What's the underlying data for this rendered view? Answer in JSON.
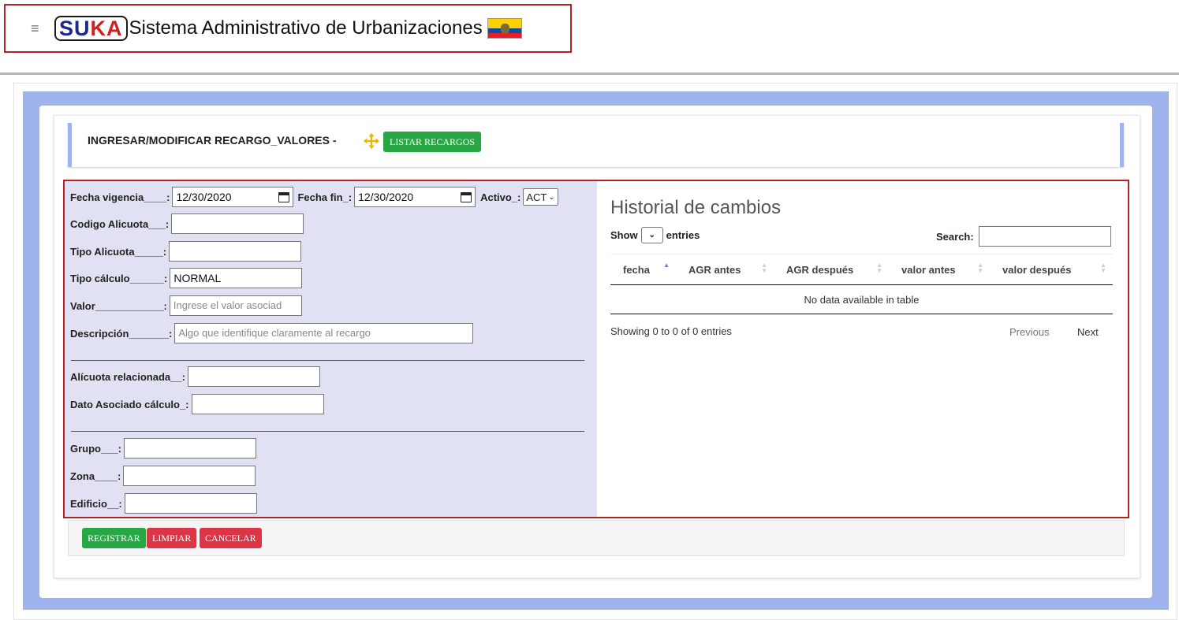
{
  "header": {
    "app_title": "Sistema Administrativo de Urbanizaciones",
    "logo_part1": "SU",
    "logo_part2": "KA",
    "menu_icon": "≡"
  },
  "panel": {
    "title": "INGRESAR/MODIFICAR RECARGO_VALORES -",
    "move_icon": "move-arrows-icon",
    "list_button": "LISTAR RECARGOS"
  },
  "form": {
    "fecha_vigencia_label": "Fecha vigencia____:",
    "fecha_vigencia_value": "12/30/2020",
    "fecha_fin_label": "Fecha fin_:",
    "fecha_fin_value": "12/30/2020",
    "activo_label": "Activo_:",
    "activo_value": "ACT",
    "codigo_label": "Codigo Alicuota___:",
    "tipo_alicuota_label": "Tipo Alicuota_____:",
    "tipo_calculo_label": "Tipo cálculo______:",
    "tipo_calculo_value": "NORMAL",
    "valor_label": "Valor____________:",
    "valor_placeholder": "Ingrese el valor asociad",
    "descripcion_label": "Descripción_______:",
    "descripcion_placeholder": "Algo que identifique claramente al recargo",
    "alicuota_rel_label": "Alícuota relacionada__:",
    "dato_asociado_label": "Dato Asociado cálculo_:",
    "grupo_label": "Grupo___:",
    "zona_label": "Zona____:",
    "edificio_label": "Edificio__:"
  },
  "history": {
    "title": "Historial de cambios",
    "show_label": "Show",
    "entries_label": "entries",
    "search_label": "Search:",
    "columns": [
      "fecha",
      "AGR antes",
      "AGR después",
      "valor antes",
      "valor después"
    ],
    "empty_message": "No data available in table",
    "info": "Showing 0 to 0 of 0 entries",
    "previous": "Previous",
    "next": "Next"
  },
  "actions": {
    "registrar": "REGISTRAR",
    "limpiar": "LIMPIAR",
    "cancelar": "CANCELAR"
  },
  "colors": {
    "accent_blue": "#9fb4ec",
    "success": "#28a745",
    "danger": "#dc3545",
    "border_red": "#b22222"
  }
}
